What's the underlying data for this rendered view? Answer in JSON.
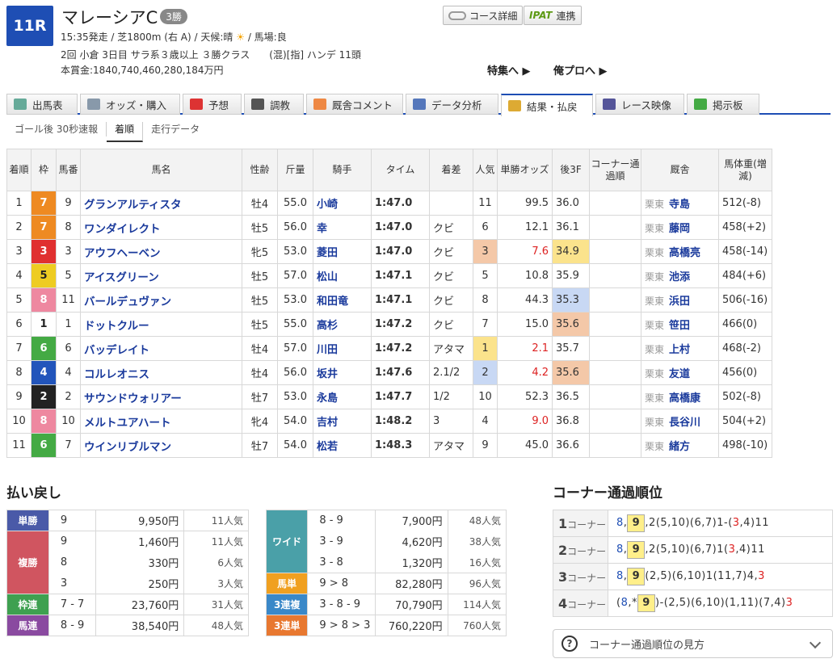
{
  "race": {
    "number": "11R",
    "name": "マレーシアC",
    "grade": "3勝",
    "info1a": "15:35発走 / 芝1800m (右 A) / 天候:晴",
    "weather_icon": "sun-icon",
    "info1b": "/ 馬場:良",
    "info2": "2回 小倉 3日目 サラ系３歳以上 ３勝クラス　　(混)[指] ハンデ 11頭",
    "info3": "本賞金:1840,740,460,280,184万円"
  },
  "buttons": {
    "course": "コース詳細",
    "ipat_logo": "IPAT",
    "ipat": "連携"
  },
  "links": {
    "feature": "特集へ ▶",
    "pro": "俺プロへ ▶"
  },
  "tabs": [
    {
      "label": "出馬表",
      "icon": "table-icon"
    },
    {
      "label": "オッズ・購入",
      "icon": "odds-icon"
    },
    {
      "label": "予想",
      "icon": "target-icon"
    },
    {
      "label": "調教",
      "icon": "stopwatch-icon"
    },
    {
      "label": "厩舎コメント",
      "icon": "stable-icon"
    },
    {
      "label": "データ分析",
      "icon": "bar-chart-icon"
    },
    {
      "label": "結果・払戻",
      "icon": "coins-icon"
    },
    {
      "label": "レース映像",
      "icon": "video-icon"
    },
    {
      "label": "掲示板",
      "icon": "chat-icon"
    }
  ],
  "subtabs": [
    "ゴール後 30秒速報",
    "着順",
    "走行データ"
  ],
  "headers": [
    "着順",
    "枠",
    "馬番",
    "馬名",
    "性齢",
    "斤量",
    "騎手",
    "タイム",
    "着差",
    "人気",
    "単勝オッズ",
    "後3F",
    "コーナー通過順",
    "厩舎",
    "馬体重(増減)"
  ],
  "results": [
    {
      "rank": "1",
      "waku": "7",
      "num": "9",
      "horse": "グランアルティスタ",
      "sex": "牡4",
      "kin": "55.0",
      "jockey": "小崎",
      "time": "1:47.0",
      "diff": "",
      "pop": "11",
      "odds": "99.5",
      "f3": "36.0",
      "east": "栗東",
      "trainer": "寺島",
      "weight": "512(-8)"
    },
    {
      "rank": "2",
      "waku": "7",
      "num": "8",
      "horse": "ワンダイレクト",
      "sex": "牡5",
      "kin": "56.0",
      "jockey": "幸",
      "time": "1:47.0",
      "diff": "クビ",
      "pop": "6",
      "odds": "12.1",
      "f3": "36.1",
      "east": "栗東",
      "trainer": "藤岡",
      "weight": "458(+2)"
    },
    {
      "rank": "3",
      "waku": "3",
      "num": "3",
      "horse": "アウフヘーベン",
      "sex": "牝5",
      "kin": "53.0",
      "jockey": "菱田",
      "time": "1:47.0",
      "diff": "クビ",
      "pop": "3",
      "odds": "7.6",
      "f3": "34.9",
      "east": "栗東",
      "trainer": "高橋亮",
      "weight": "458(-14)"
    },
    {
      "rank": "4",
      "waku": "5",
      "num": "5",
      "horse": "アイスグリーン",
      "sex": "牡5",
      "kin": "57.0",
      "jockey": "松山",
      "time": "1:47.1",
      "diff": "クビ",
      "pop": "5",
      "odds": "10.8",
      "f3": "35.9",
      "east": "栗東",
      "trainer": "池添",
      "weight": "484(+6)"
    },
    {
      "rank": "5",
      "waku": "8",
      "num": "11",
      "horse": "バールデュヴァン",
      "sex": "牡5",
      "kin": "53.0",
      "jockey": "和田竜",
      "time": "1:47.1",
      "diff": "クビ",
      "pop": "8",
      "odds": "44.3",
      "f3": "35.3",
      "east": "栗東",
      "trainer": "浜田",
      "weight": "506(-16)"
    },
    {
      "rank": "6",
      "waku": "1",
      "num": "1",
      "horse": "ドットクルー",
      "sex": "牡5",
      "kin": "55.0",
      "jockey": "高杉",
      "time": "1:47.2",
      "diff": "クビ",
      "pop": "7",
      "odds": "15.0",
      "f3": "35.6",
      "east": "栗東",
      "trainer": "笹田",
      "weight": "466(0)"
    },
    {
      "rank": "7",
      "waku": "6",
      "num": "6",
      "horse": "バッデレイト",
      "sex": "牡4",
      "kin": "57.0",
      "jockey": "川田",
      "time": "1:47.2",
      "diff": "アタマ",
      "pop": "1",
      "odds": "2.1",
      "f3": "35.7",
      "east": "栗東",
      "trainer": "上村",
      "weight": "468(-2)"
    },
    {
      "rank": "8",
      "waku": "4",
      "num": "4",
      "horse": "コルレオニス",
      "sex": "牡4",
      "kin": "56.0",
      "jockey": "坂井",
      "time": "1:47.6",
      "diff": "2.1/2",
      "pop": "2",
      "odds": "4.2",
      "f3": "35.6",
      "east": "栗東",
      "trainer": "友道",
      "weight": "456(0)"
    },
    {
      "rank": "9",
      "waku": "2",
      "num": "2",
      "horse": "サウンドウォリアー",
      "sex": "牡7",
      "kin": "53.0",
      "jockey": "永島",
      "time": "1:47.7",
      "diff": "1/2",
      "pop": "10",
      "odds": "52.3",
      "f3": "36.5",
      "east": "栗東",
      "trainer": "高橋康",
      "weight": "502(-8)"
    },
    {
      "rank": "10",
      "waku": "8",
      "num": "10",
      "horse": "メルトユアハート",
      "sex": "牝4",
      "kin": "54.0",
      "jockey": "吉村",
      "time": "1:48.2",
      "diff": "3",
      "pop": "4",
      "odds": "9.0",
      "f3": "36.8",
      "east": "栗東",
      "trainer": "長谷川",
      "weight": "504(+2)"
    },
    {
      "rank": "11",
      "waku": "6",
      "num": "7",
      "horse": "ウインリブルマン",
      "sex": "牡7",
      "kin": "54.0",
      "jockey": "松若",
      "time": "1:48.3",
      "diff": "アタマ",
      "pop": "9",
      "odds": "45.0",
      "f3": "36.6",
      "east": "栗東",
      "trainer": "緒方",
      "weight": "498(-10)"
    }
  ],
  "waku_colors": {
    "1": "#ffffff",
    "2": "#222222",
    "3": "#e03030",
    "4": "#2255bb",
    "5": "#eecc22",
    "6": "#44aa44",
    "7": "#ee8a22",
    "8": "#ee88a0"
  },
  "pop_colors": {
    "1": "#fbe38c",
    "2": "#c8d8f4",
    "3": "#f4c8a8"
  },
  "f3_colors": {
    "34.9": "#fbe38c",
    "35.3": "#c8d8f4",
    "35.6": "#f4c8a8"
  },
  "payout_title": "払い戻し",
  "payout_left": [
    {
      "label": "単勝",
      "color": "#4a5aa8",
      "rows": [
        {
          "combo": "9",
          "amount": "9,950円",
          "pop": "11人気"
        }
      ]
    },
    {
      "label": "複勝",
      "color": "#d05560",
      "rows": [
        {
          "combo": "9",
          "amount": "1,460円",
          "pop": "11人気"
        },
        {
          "combo": "8",
          "amount": "330円",
          "pop": "6人気"
        },
        {
          "combo": "3",
          "amount": "250円",
          "pop": "3人気"
        }
      ]
    },
    {
      "label": "枠連",
      "color": "#3ea050",
      "rows": [
        {
          "combo": "7 - 7",
          "amount": "23,760円",
          "pop": "31人気"
        }
      ]
    },
    {
      "label": "馬連",
      "color": "#8a4aa0",
      "rows": [
        {
          "combo": "8 - 9",
          "amount": "38,540円",
          "pop": "48人気"
        }
      ]
    }
  ],
  "payout_right": [
    {
      "label": "ワイド",
      "color": "#4aa0a8",
      "rows": [
        {
          "combo": "8 - 9",
          "amount": "7,900円",
          "pop": "48人気"
        },
        {
          "combo": "3 - 9",
          "amount": "4,620円",
          "pop": "38人気"
        },
        {
          "combo": "3 - 8",
          "amount": "1,320円",
          "pop": "16人気"
        }
      ]
    },
    {
      "label": "馬単",
      "color": "#f0a020",
      "rows": [
        {
          "combo": "9 > 8",
          "amount": "82,280円",
          "pop": "96人気"
        }
      ]
    },
    {
      "label": "3連複",
      "color": "#3a88c8",
      "rows": [
        {
          "combo": "3 - 8 - 9",
          "amount": "70,790円",
          "pop": "114人気"
        }
      ]
    },
    {
      "label": "3連単",
      "color": "#e87830",
      "rows": [
        {
          "combo": "9 > 8 > 3",
          "amount": "760,220円",
          "pop": "760人気"
        }
      ]
    }
  ],
  "corner_title": "コーナー通過順位",
  "corners": [
    {
      "num": "1",
      "label": "コーナー",
      "pre": "8,",
      "hl": "9",
      "post_a": ",2(5,10)(6,7)1-(",
      "red": "3",
      "post_b": ",4)11"
    },
    {
      "num": "2",
      "label": "コーナー",
      "pre": "8,",
      "hl": "9",
      "post_a": ",2(5,10)(6,7)1(",
      "red": "3",
      "post_b": ",4)11"
    },
    {
      "num": "3",
      "label": "コーナー",
      "pre": "8,",
      "hl": "9",
      "post_a": "(2,5)(6,10)1(11,7)4,",
      "red": "3",
      "post_b": ""
    },
    {
      "num": "4",
      "label": "コーナー",
      "pre": "(8,*",
      "hl": "9",
      "post_a": ")-(2,5)(6,10)(1,11)(7,4)",
      "red": "3",
      "post_b": ""
    }
  ],
  "howto": "コーナー通過順位の見方"
}
